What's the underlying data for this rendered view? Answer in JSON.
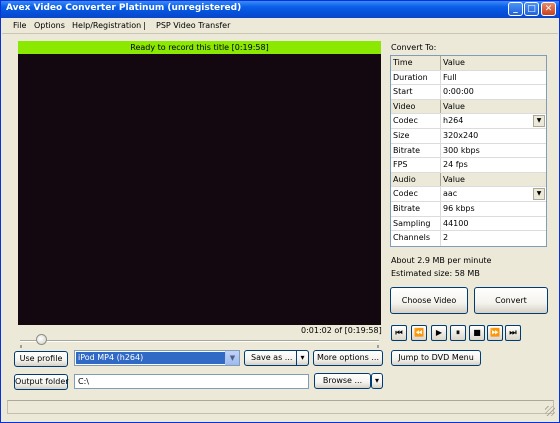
{
  "window": {
    "title": "Avex Video Converter Platinum  (unregistered)",
    "min_label": "_",
    "max_label": "□",
    "close_label": "✕"
  },
  "menu": {
    "file": "File",
    "options": "Options",
    "help": "Help/Registration",
    "separator": "|",
    "psp": "PSP Video Transfer"
  },
  "player": {
    "status": "Ready to record this title [0:19:58]",
    "time": "0:01:02 of [0:19:58]",
    "progress_fraction": 0.05
  },
  "profile": {
    "use_profile_label": "Use profile",
    "selected": "iPod MP4 (h264)",
    "save_as_label": "Save as ...",
    "more_options_label": "More options ...",
    "output_folder_label": "Output folder",
    "output_path": "C:\\",
    "browse_label": "Browse ...",
    "dvd_menu_label": "Jump to DVD Menu"
  },
  "settings": {
    "convert_to_label": "Convert To:",
    "time_header": [
      "Time",
      "Value"
    ],
    "time_rows": [
      [
        "Duration",
        "Full"
      ],
      [
        "Start",
        "0:00:00"
      ]
    ],
    "video_header": [
      "Video",
      "Value"
    ],
    "video_rows": [
      [
        "Codec",
        "h264"
      ],
      [
        "Size",
        "320x240"
      ],
      [
        "Bitrate",
        "300 kbps"
      ],
      [
        "FPS",
        "24 fps"
      ]
    ],
    "audio_header": [
      "Audio",
      "Value"
    ],
    "audio_rows": [
      [
        "Codec",
        "aac"
      ],
      [
        "Bitrate",
        "96 kbps"
      ],
      [
        "Sampling",
        "44100"
      ],
      [
        "Channels",
        "2"
      ]
    ],
    "about": "About 2.9 MB per minute",
    "estimated": "Estimated size: 58 MB"
  },
  "actions": {
    "choose_video": "Choose Video",
    "convert": "Convert"
  },
  "transport": {
    "first": "⏮",
    "prev": "⏪",
    "play": "▶",
    "pause": "⏸",
    "stop": "■",
    "next": "⏩",
    "last": "⏭"
  },
  "colors": {
    "status_green": "#8be800",
    "video_bg": "#130710",
    "titlebar_blue": "#0a5ee8"
  }
}
